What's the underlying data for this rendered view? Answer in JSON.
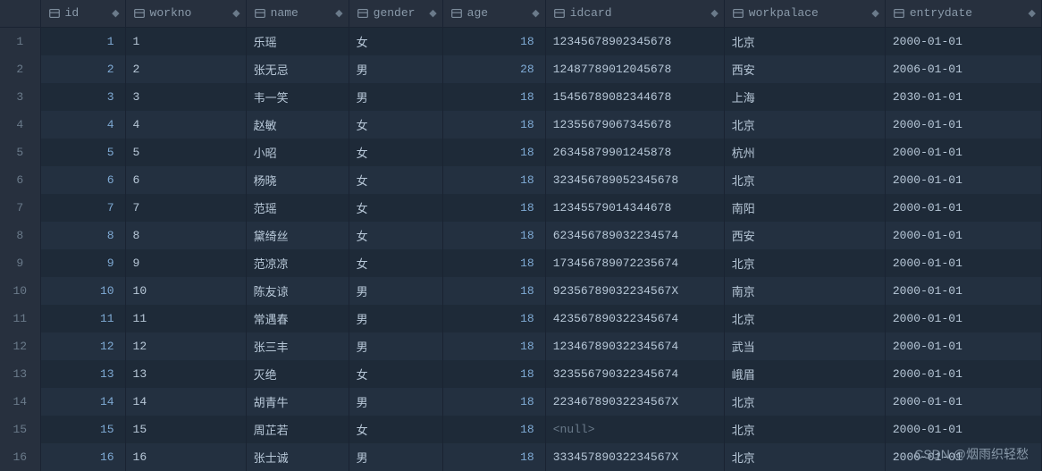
{
  "columns": {
    "id": "id",
    "workno": "workno",
    "name": "name",
    "gender": "gender",
    "age": "age",
    "idcard": "idcard",
    "workpalace": "workpalace",
    "entrydate": "entrydate"
  },
  "rows": [
    {
      "rownum": "1",
      "id": "1",
      "workno": "1",
      "name": "乐瑶",
      "gender": "女",
      "age": "18",
      "idcard": "1234567890234567​8",
      "workpalace": "北京",
      "entrydate": "2000-01-01"
    },
    {
      "rownum": "2",
      "id": "2",
      "workno": "2",
      "name": "张无忌",
      "gender": "男",
      "age": "28",
      "idcard": "12487789012045678",
      "workpalace": "西安",
      "entrydate": "2006-01-01"
    },
    {
      "rownum": "3",
      "id": "3",
      "workno": "3",
      "name": "韦一笑",
      "gender": "男",
      "age": "18",
      "idcard": "15456789082344678",
      "workpalace": "上海",
      "entrydate": "2030-01-01"
    },
    {
      "rownum": "4",
      "id": "4",
      "workno": "4",
      "name": "赵敏",
      "gender": "女",
      "age": "18",
      "idcard": "12355679067345678",
      "workpalace": "北京",
      "entrydate": "2000-01-01"
    },
    {
      "rownum": "5",
      "id": "5",
      "workno": "5",
      "name": "小昭",
      "gender": "女",
      "age": "18",
      "idcard": "26345879901245878",
      "workpalace": "杭州",
      "entrydate": "2000-01-01"
    },
    {
      "rownum": "6",
      "id": "6",
      "workno": "6",
      "name": "杨晓",
      "gender": "女",
      "age": "18",
      "idcard": "323456789052345678",
      "workpalace": "北京",
      "entrydate": "2000-01-01"
    },
    {
      "rownum": "7",
      "id": "7",
      "workno": "7",
      "name": "范瑶",
      "gender": "女",
      "age": "18",
      "idcard": "12345579014344678",
      "workpalace": "南阳",
      "entrydate": "2000-01-01"
    },
    {
      "rownum": "8",
      "id": "8",
      "workno": "8",
      "name": "黛绮丝",
      "gender": "女",
      "age": "18",
      "idcard": "623456789032234574",
      "workpalace": "西安",
      "entrydate": "2000-01-01"
    },
    {
      "rownum": "9",
      "id": "9",
      "workno": "9",
      "name": "范凉凉",
      "gender": "女",
      "age": "18",
      "idcard": "173456789072235674",
      "workpalace": "北京",
      "entrydate": "2000-01-01"
    },
    {
      "rownum": "10",
      "id": "10",
      "workno": "10",
      "name": "陈友谅",
      "gender": "男",
      "age": "18",
      "idcard": "92356789032234567X",
      "workpalace": "南京",
      "entrydate": "2000-01-01"
    },
    {
      "rownum": "11",
      "id": "11",
      "workno": "11",
      "name": "常遇春",
      "gender": "男",
      "age": "18",
      "idcard": "423567890322345674",
      "workpalace": "北京",
      "entrydate": "2000-01-01"
    },
    {
      "rownum": "12",
      "id": "12",
      "workno": "12",
      "name": "张三丰",
      "gender": "男",
      "age": "18",
      "idcard": "123467890322345674",
      "workpalace": "武当",
      "entrydate": "2000-01-01"
    },
    {
      "rownum": "13",
      "id": "13",
      "workno": "13",
      "name": "灭绝",
      "gender": "女",
      "age": "18",
      "idcard": "323556790322345674",
      "workpalace": "峨眉",
      "entrydate": "2000-01-01"
    },
    {
      "rownum": "14",
      "id": "14",
      "workno": "14",
      "name": "胡青牛",
      "gender": "男",
      "age": "18",
      "idcard": "22346789032234567X",
      "workpalace": "北京",
      "entrydate": "2000-01-01"
    },
    {
      "rownum": "15",
      "id": "15",
      "workno": "15",
      "name": "周芷若",
      "gender": "女",
      "age": "18",
      "idcard": "<null>",
      "workpalace": "北京",
      "entrydate": "2000-01-01"
    },
    {
      "rownum": "16",
      "id": "16",
      "workno": "16",
      "name": "张士诚",
      "gender": "男",
      "age": "18",
      "idcard": "33345789032234567X",
      "workpalace": "北京",
      "entrydate": "2000-01-01"
    }
  ],
  "watermark": "CSDN @烟雨织轻愁"
}
